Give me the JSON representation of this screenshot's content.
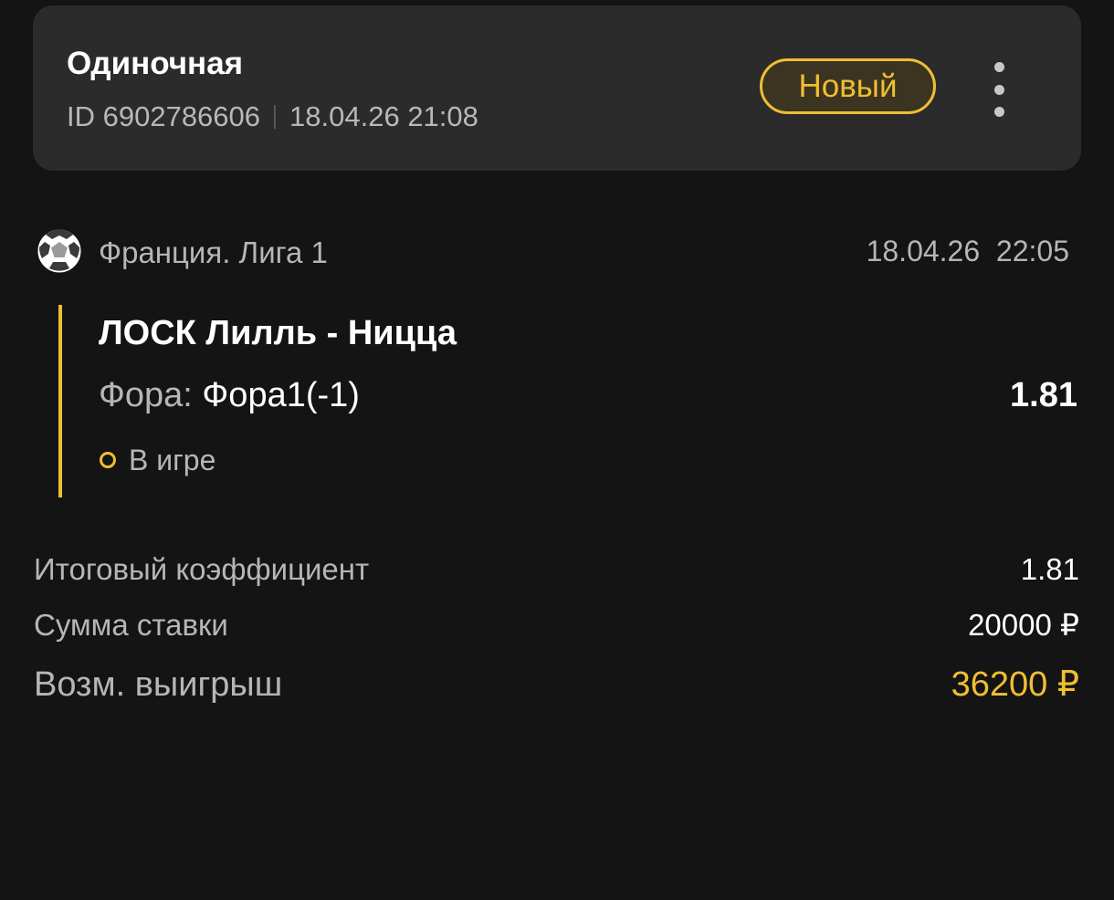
{
  "ticket": {
    "type": "Одиночная",
    "id": "ID 6902786606",
    "datetime": "18.04.26 21:08",
    "status_badge": "Новый"
  },
  "event": {
    "league": "Франция. Лига 1",
    "datetime": "18.04.26  22:05",
    "match": "ЛОСК Лилль - Ницца",
    "market_label": "Фора:",
    "market_value": "Фора1(-1)",
    "odd": "1.81",
    "state": "В игре",
    "sport_icon": "soccer-ball-icon"
  },
  "summary": {
    "total_odd_label": "Итоговый коэффициент",
    "total_odd_value": "1.81",
    "stake_label": "Сумма ставки",
    "stake_value": "20000 ₽",
    "win_label": "Возм. выигрыш",
    "win_value": "36200 ₽"
  },
  "colors": {
    "background": "#141414",
    "card": "#2b2b2b",
    "accent": "#f0be32",
    "muted_text": "#b6b6b6"
  }
}
